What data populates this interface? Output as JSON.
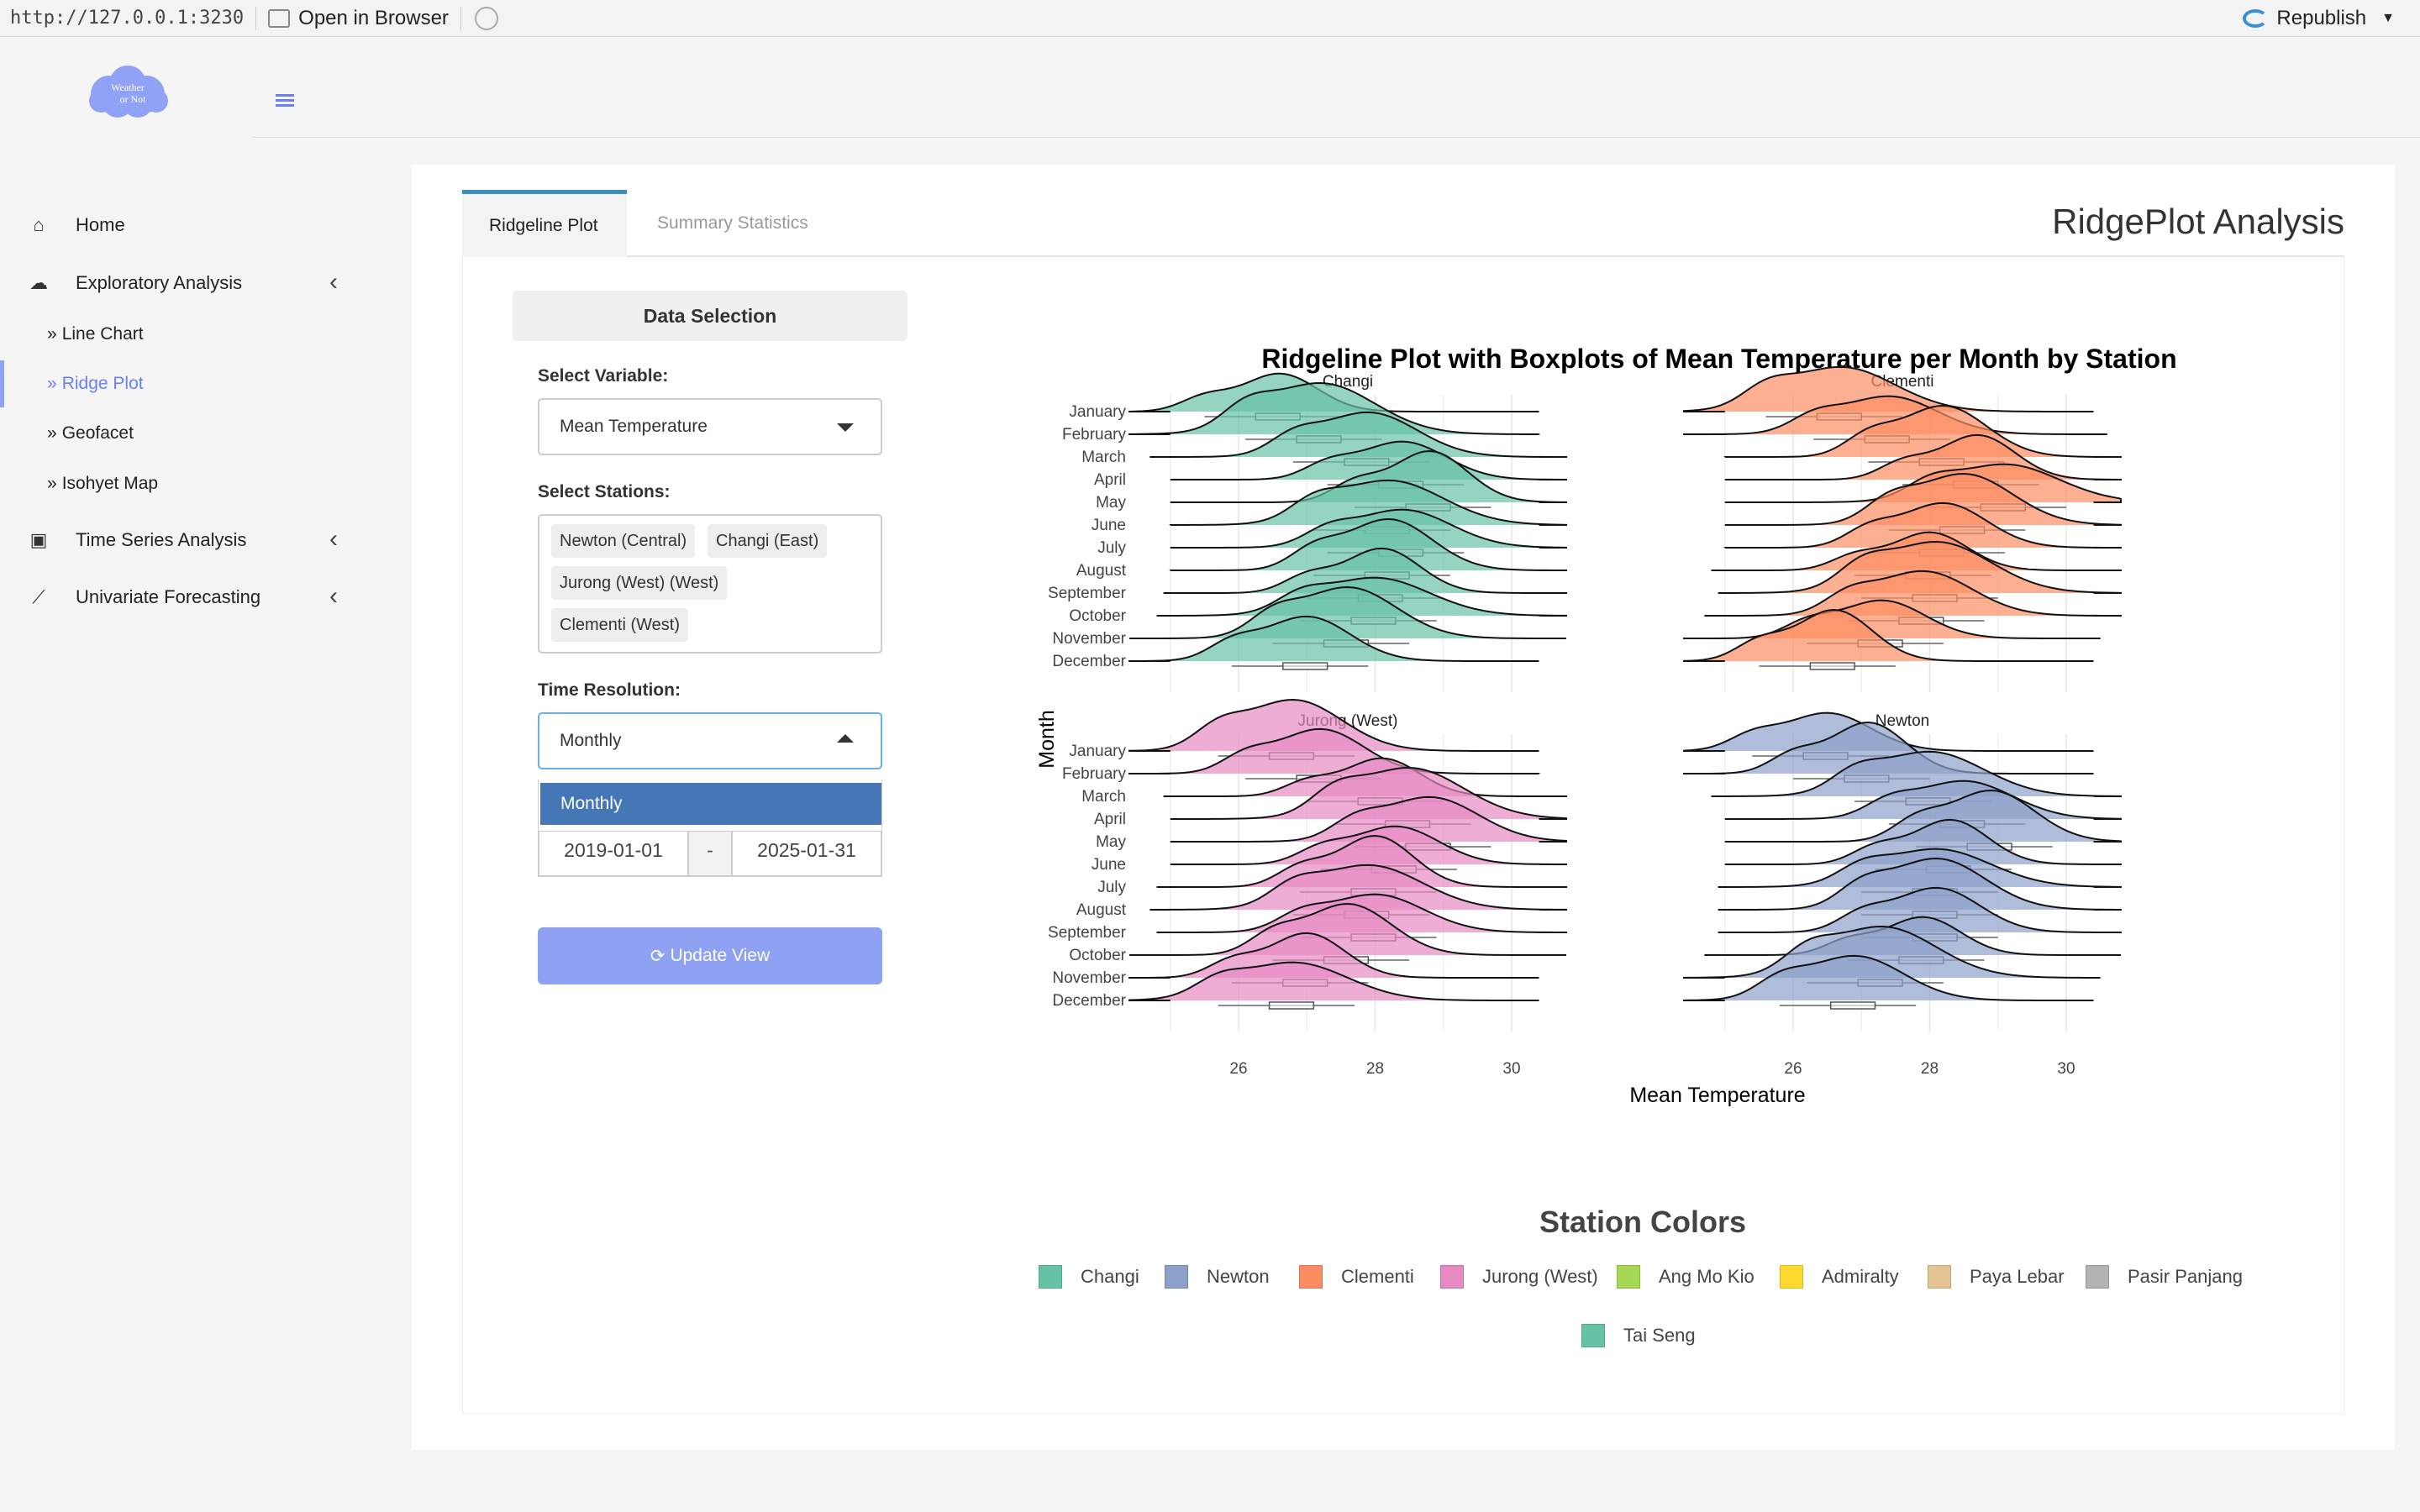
{
  "topbar": {
    "url": "http://127.0.0.1:3230",
    "open_browser": "Open in Browser",
    "republish": "Republish"
  },
  "sidebar": {
    "logo_line1": "Weather",
    "logo_line2": "or Not",
    "items": {
      "home": "Home",
      "exploratory": "Exploratory Analysis",
      "line_chart": "Line Chart",
      "ridge_plot": "Ridge Plot",
      "geofacet": "Geofacet",
      "isohyet": "Isohyet Map",
      "time_series": "Time Series Analysis",
      "forecasting": "Univariate Forecasting"
    },
    "sub_prefix": "»",
    "accent": "#6b7ff0"
  },
  "tabs": {
    "ridgeline": "Ridgeline Plot",
    "summary": "Summary Statistics",
    "title": "RidgePlot Analysis"
  },
  "controls": {
    "section_title": "Data Selection",
    "variable_label": "Select Variable:",
    "variable_value": "Mean Temperature",
    "stations_label": "Select Stations:",
    "stations": [
      "Newton (Central)",
      "Changi (East)",
      "Jurong (West) (West)",
      "Clementi (West)"
    ],
    "resolution_label": "Time Resolution:",
    "resolution_value": "Monthly",
    "resolution_options": [
      "Monthly"
    ],
    "date_start": "2019-01-01",
    "date_sep": "-",
    "date_end": "2025-01-31",
    "update_button": "Update View"
  },
  "chart_data": {
    "type": "ridgeline",
    "title": "Ridgeline Plot with Boxplots of Mean Temperature per Month by Station",
    "xlabel": "Mean Temperature",
    "ylabel": "Month",
    "xlim": [
      24.4,
      30.8
    ],
    "x_ticks": [
      26,
      28,
      30
    ],
    "months": [
      "January",
      "February",
      "March",
      "April",
      "May",
      "June",
      "July",
      "August",
      "September",
      "October",
      "November",
      "December"
    ],
    "panels": [
      {
        "name": "Changi",
        "color": "#66c2a5",
        "modes": [
          [
            26.6
          ],
          [
            27.2
          ],
          [
            27.9
          ],
          [
            28.4
          ],
          [
            28.8
          ],
          [
            28.2
          ],
          [
            28.4
          ],
          [
            28.2
          ],
          [
            28.1
          ],
          [
            28.0
          ],
          [
            27.6
          ],
          [
            27.0
          ]
        ]
      },
      {
        "name": "Clementi",
        "color": "#fc8d62",
        "modes": [
          [
            26.7
          ],
          [
            27.4
          ],
          [
            28.2
          ],
          [
            28.7
          ],
          [
            29.1
          ],
          [
            28.5
          ],
          [
            28.2
          ],
          [
            28.0
          ],
          [
            28.1
          ],
          [
            27.9
          ],
          [
            27.3
          ],
          [
            26.6
          ]
        ]
      },
      {
        "name": "Jurong (West)",
        "color": "#e78ac3",
        "modes": [
          [
            26.8
          ],
          [
            27.2
          ],
          [
            28.1
          ],
          [
            28.5
          ],
          [
            28.8
          ],
          [
            28.3
          ],
          [
            28.0
          ],
          [
            27.9
          ],
          [
            28.0
          ],
          [
            27.6
          ],
          [
            27.0
          ],
          [
            26.8
          ]
        ]
      },
      {
        "name": "Newton",
        "color": "#8da0cb",
        "modes": [
          [
            26.5
          ],
          [
            27.1
          ],
          [
            28.0
          ],
          [
            28.5
          ],
          [
            28.9
          ],
          [
            28.3
          ],
          [
            28.1
          ],
          [
            28.1
          ],
          [
            28.1
          ],
          [
            27.9
          ],
          [
            27.3
          ],
          [
            26.9
          ]
        ]
      }
    ]
  },
  "legend": {
    "title": "Station Colors",
    "items": [
      {
        "name": "Changi",
        "color": "#66c2a5"
      },
      {
        "name": "Newton",
        "color": "#8da0cb"
      },
      {
        "name": "Clementi",
        "color": "#fc8d62"
      },
      {
        "name": "Jurong (West)",
        "color": "#e78ac3"
      },
      {
        "name": "Ang Mo Kio",
        "color": "#a6d854"
      },
      {
        "name": "Admiralty",
        "color": "#ffd92f"
      },
      {
        "name": "Paya Lebar",
        "color": "#e5c494"
      },
      {
        "name": "Pasir Panjang",
        "color": "#b3b3b3"
      },
      {
        "name": "Tai Seng",
        "color": "#66c2a5"
      }
    ]
  }
}
